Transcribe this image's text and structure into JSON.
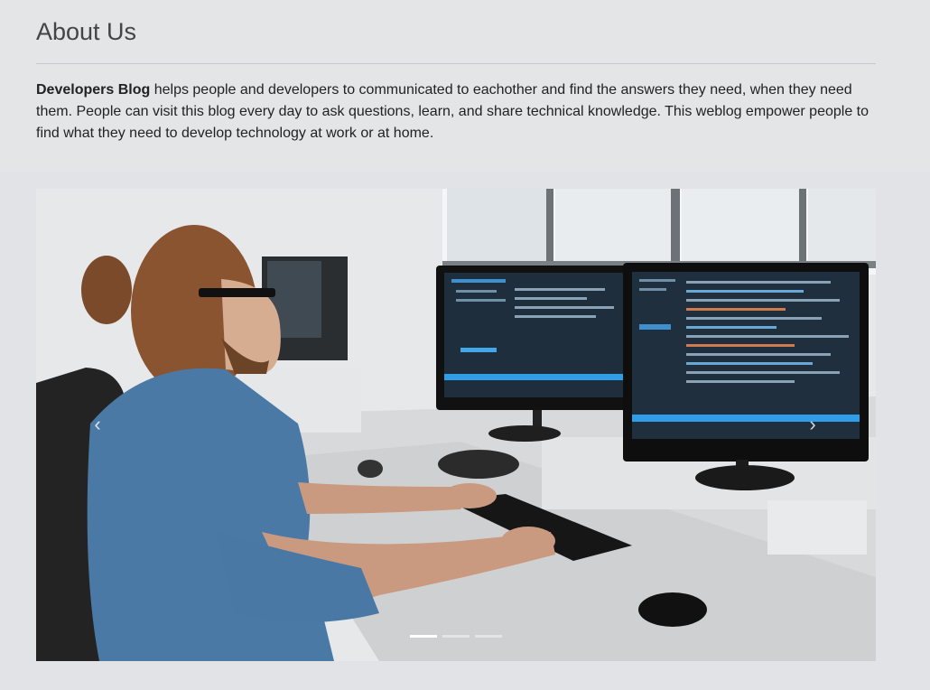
{
  "about": {
    "title": "About Us",
    "brand": "Developers Blog",
    "text": " helps people and developers to communicated to eachother and find the answers they need, when they need them. People can visit this blog every day to ask questions, learn, and share technical knowledge. This weblog empower people to find what they need to develop technology at work or at home."
  },
  "carousel": {
    "prev_icon": "‹",
    "next_icon": "›",
    "slide_count": 3,
    "active_index": 0
  }
}
